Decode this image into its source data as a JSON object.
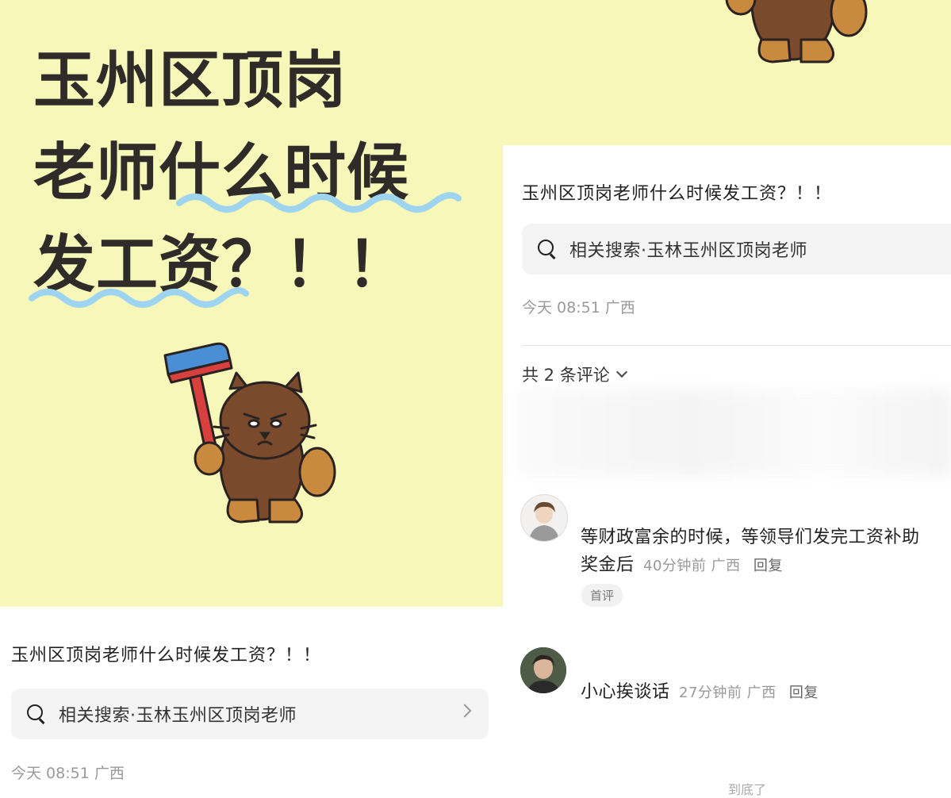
{
  "poster": {
    "title": "玉州区顶岗\n老师什么时候\n发工资？！！",
    "background": "#f6f7b9",
    "underline_color": "#9fd4f0"
  },
  "left_post": {
    "title": "玉州区顶岗老师什么时候发工资？！！",
    "search_label": "相关搜索·玉林玉州区顶岗老师",
    "meta": "今天 08:51 广西"
  },
  "right_post": {
    "title": "玉州区顶岗老师什么时候发工资？！！",
    "search_label": "相关搜索·玉林玉州区顶岗老师",
    "meta": "今天 08:51 广西",
    "comments_count": "共 2 条评论",
    "comments": [
      {
        "text": "等财政富余的时候，等领导们发完工资补助奖金后",
        "time": "40分钟前",
        "location": "广西",
        "reply": "回复",
        "badge": "首评"
      },
      {
        "text": "小心挨谈话",
        "time": "27分钟前",
        "location": "广西",
        "reply": "回复"
      }
    ],
    "bottom_partial": "到底了"
  }
}
